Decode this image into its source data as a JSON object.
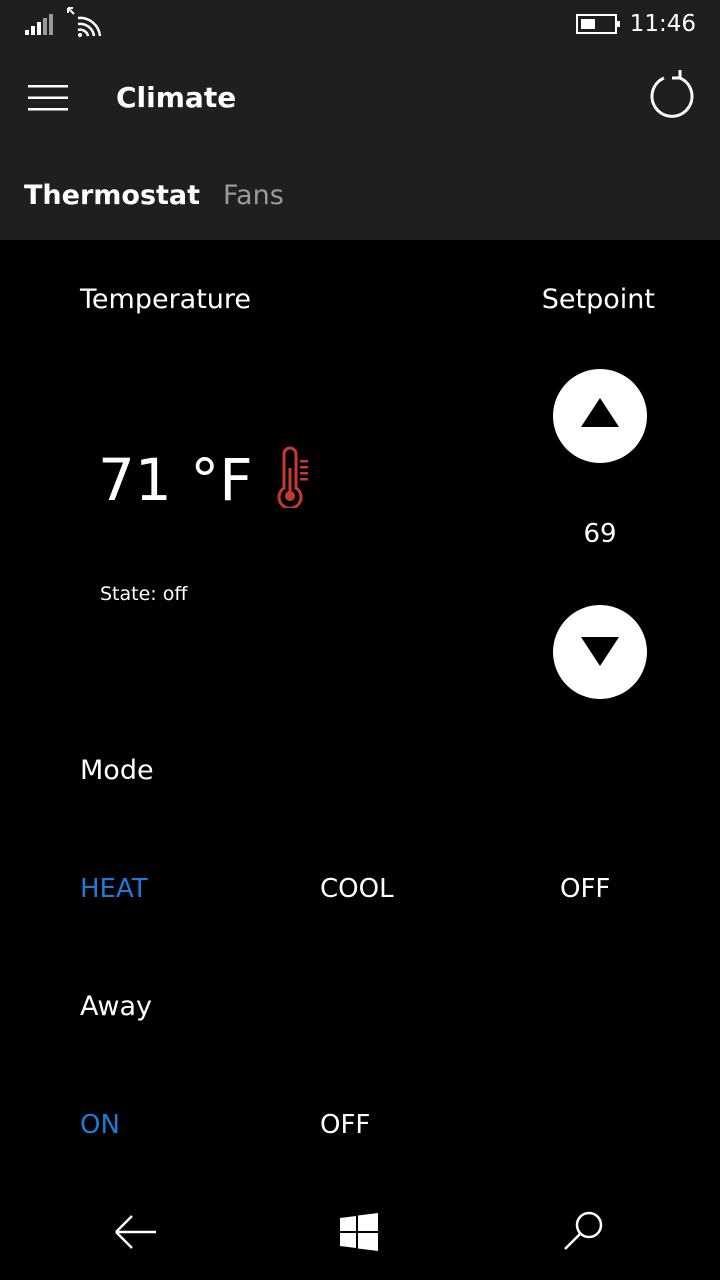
{
  "status_bar": {
    "time": "11:46",
    "icons": [
      "signal-icon",
      "wifi-icon",
      "battery-icon"
    ]
  },
  "app_bar": {
    "title": "Climate",
    "menu_icon": "hamburger-icon",
    "refresh_icon": "refresh-icon"
  },
  "pivot": {
    "tabs": [
      {
        "label": "Thermostat",
        "active": true
      },
      {
        "label": "Fans",
        "active": false
      }
    ]
  },
  "thermostat": {
    "temperature_label": "Temperature",
    "temperature_value": "71 °F",
    "thermometer_icon": "thermometer-icon",
    "state_text": "State: off",
    "setpoint_label": "Setpoint",
    "setpoint_value": "69"
  },
  "mode": {
    "label": "Mode",
    "options": [
      {
        "label": "HEAT",
        "selected": true
      },
      {
        "label": "COOL",
        "selected": false
      },
      {
        "label": "OFF",
        "selected": false
      }
    ]
  },
  "away": {
    "label": "Away",
    "options": [
      {
        "label": "ON",
        "selected": true
      },
      {
        "label": "OFF",
        "selected": false
      }
    ]
  },
  "nav_bar": {
    "icons": [
      "back-arrow-icon",
      "windows-start-icon",
      "search-icon"
    ]
  },
  "colors": {
    "chrome_background": "#1f1f1f",
    "page_background": "#000000",
    "accent": "#1e7ad9",
    "thermometer": "#c7392f",
    "inactive_tab": "#9a9a9a"
  }
}
